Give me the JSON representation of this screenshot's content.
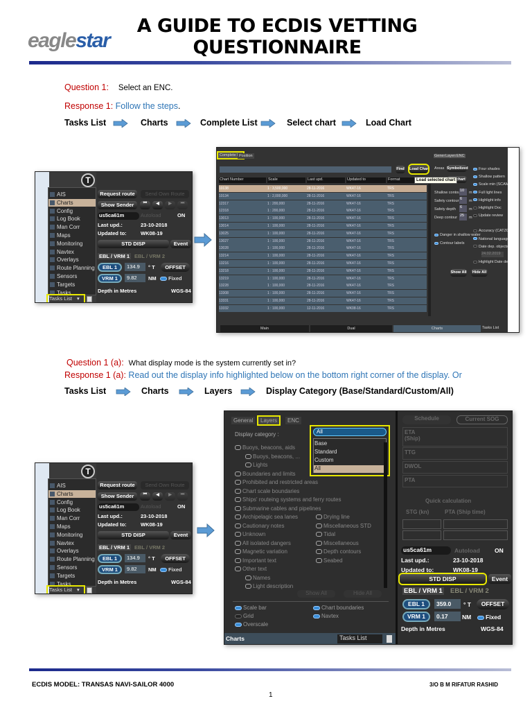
{
  "header": {
    "logo": {
      "part1": "eagle",
      "part2": "star"
    },
    "title_line1": "A GUIDE TO ECDIS VETTING",
    "title_line2": "QUESTIONNAIRE"
  },
  "q1": {
    "question_label": "Question 1:",
    "question_text": "Select an ENC.",
    "response_label": "Response 1:",
    "response_text": "Follow the steps",
    "response_end": ".",
    "steps": [
      "Tasks List",
      "Charts",
      "Complete List",
      "Select chart",
      "Load Chart"
    ]
  },
  "q1a": {
    "question_label": "Question 1 (a):",
    "question_text": "What display mode is the system currently set in?",
    "response_label": "Response 1 (a):",
    "response_text": "Read out the display info highlighted below on the bottom right corner of the display. Or",
    "steps": [
      "Tasks List",
      "Charts",
      "Layers",
      "Display Category (Base/Standard/Custom/All)"
    ]
  },
  "small_panel": {
    "t_button": "T",
    "menu": [
      "AIS",
      "Charts",
      "Config",
      "Log Book",
      "Man Corr",
      "Maps",
      "Monitoring",
      "Navtex",
      "Overlays",
      "Route Planning",
      "Sensors",
      "Targets",
      "Tasks"
    ],
    "selected": "Charts",
    "request_route": "Request route",
    "send_own_route": "Send Own Route",
    "show_sender": "Show Sender",
    "chart_select": "us5ca61m",
    "autoload": "Autoload",
    "autoload_state": "ON",
    "last_upd_label": "Last upd.:",
    "last_upd": "23-10-2018",
    "updated_to_label": "Updated to:",
    "updated_to": "WK08-19",
    "std_disp": "STD DISP",
    "event": "Event",
    "ebl_tab1": "EBL / VRM 1",
    "ebl_tab2": "EBL / VRM 2",
    "ebl1": "EBL 1",
    "ebl_value": "134.9",
    "ebl_unit": "° T",
    "offset": "OFFSET",
    "vrm1": "VRM 1",
    "vrm_value": "9.82",
    "vrm_unit": "NM",
    "fixed": "Fixed",
    "depth": "Depth in Metres",
    "datum": "WGS-84",
    "tasks_list": "Tasks List"
  },
  "chart_list": {
    "tabs": [
      "Complete list",
      "Position"
    ],
    "find": "Find",
    "load_chart": "Load Chart",
    "tooltip": "Load selected chart",
    "columns": [
      "Chart Number",
      "Scale",
      "Last upd.",
      "Updated to",
      "Format"
    ],
    "rows": [
      [
        "10138",
        "1 : 3,500,000",
        "28-11-2016",
        "WK47-16",
        "TRS"
      ],
      [
        "10134",
        "1 : 2,000,000",
        "28-11-2016",
        "WK47-16",
        "TRS"
      ],
      [
        "12317",
        "1 : 200,000",
        "28-11-2016",
        "WK47-16",
        "TRS"
      ],
      [
        "12318",
        "1 : 200,000",
        "28-11-2016",
        "WK47-16",
        "TRS"
      ],
      [
        "13013",
        "1 : 100,000",
        "28-11-2016",
        "WK47-16",
        "TRS"
      ],
      [
        "13014",
        "1 : 100,000",
        "28-11-2016",
        "WK47-16",
        "TRS"
      ],
      [
        "13025",
        "1 : 100,000",
        "28-11-2016",
        "WK47-16",
        "TRS"
      ],
      [
        "13027",
        "1 : 100,000",
        "28-11-2016",
        "WK47-16",
        "TRS"
      ],
      [
        "13028",
        "1 : 100,000",
        "28-11-2016",
        "WK47-16",
        "TRS"
      ],
      [
        "13214",
        "1 : 100,000",
        "28-11-2016",
        "WK47-16",
        "TRS"
      ],
      [
        "13216",
        "1 : 100,000",
        "28-11-2016",
        "WK47-16",
        "TRS"
      ],
      [
        "13218",
        "1 : 100,000",
        "28-11-2016",
        "WK47-16",
        "TRS"
      ],
      [
        "13219",
        "1 : 100,000",
        "28-11-2016",
        "WK47-16",
        "TRS"
      ],
      [
        "13228",
        "1 : 100,000",
        "28-11-2016",
        "WK47-16",
        "TRS"
      ],
      [
        "13308",
        "1 : 100,000",
        "28-11-2016",
        "WK47-16",
        "TRS"
      ],
      [
        "13331",
        "1 : 100,000",
        "28-11-2016",
        "WK47-16",
        "TRS"
      ],
      [
        "13332",
        "1 : 100,000",
        "12-11-2016",
        "WK08-16",
        "TRS"
      ]
    ],
    "side_tabs": [
      "General",
      "Layers",
      "ENC"
    ],
    "areas_label": "Areas",
    "areas_value": "Symbolized",
    "second_select": "Full chart",
    "contours": [
      {
        "label": "Shallow contour",
        "value": "10"
      },
      {
        "label": "Safety contour",
        "value": "6"
      },
      {
        "label": "Safety depth",
        "value": "6"
      },
      {
        "label": "Deep contour",
        "value": "25"
      }
    ],
    "left_toggles": [
      "Danger in shallow water",
      "Contour labels"
    ],
    "right_toggles": [
      {
        "label": "Four shades",
        "on": true
      },
      {
        "label": "Shallow pattern",
        "on": true
      },
      {
        "label": "Scale min (SCAMIN)",
        "on": true
      },
      {
        "label": "Full light lines",
        "on": true
      },
      {
        "label": "Highlight info",
        "on": true
      },
      {
        "label": "Highlight Doc",
        "on": false
      },
      {
        "label": "Update review",
        "on": false
      },
      {
        "label": "Accuracy (CATZOC)",
        "on": false
      },
      {
        "label": "National language",
        "on": true
      },
      {
        "label": "Date dep. objects",
        "on": false
      },
      {
        "label": "Highlight Date dep.",
        "on": false
      }
    ],
    "date_value": "24.02.2019",
    "show_all": "Show All",
    "hide_all": "Hide All",
    "bottom_tabs": [
      "Main",
      "Dual",
      "Charts"
    ],
    "tasks_list": "Tasks List"
  },
  "layers_panel": {
    "tabs": [
      "General",
      "Layers",
      "ENC"
    ],
    "display_category_label": "Display category :",
    "display_category_value": "All",
    "options": [
      "Base",
      "Standard",
      "Custom",
      "All"
    ],
    "layers_left": [
      "Buoys, beacons, aids",
      "Buoys, beacons, ...",
      "Lights",
      "Boundaries and limits",
      "Prohibited and restricted areas",
      "Chart scale boundaries",
      "Ships' routeing systems and ferry routes",
      "Submarine cables and pipelines",
      "Archipelagic sea lanes",
      "Cautionary notes",
      "Unknown",
      "All isolated dangers",
      "Magnetic variation",
      "Important text",
      "Other text",
      "Names",
      "Light description"
    ],
    "layers_right": [
      "Drying line",
      "Miscellaneous STD",
      "Tidal",
      "Miscellaneous",
      "Depth contours",
      "Seabed"
    ],
    "show_all": "Show All",
    "hide_all": "Hide All",
    "toggles": [
      {
        "label": "Scale bar",
        "on": true
      },
      {
        "label": "Chart boundaries",
        "on": true
      },
      {
        "label": "Grid",
        "on": false
      },
      {
        "label": "Navtex",
        "on": true
      },
      {
        "label": "Overscale",
        "on": true
      }
    ],
    "bottom_label": "Charts",
    "tasks_list": "Tasks List",
    "schedule": "Schedule",
    "current_sog": "Current SOG",
    "schedule_rows": [
      "ETA (Ship)",
      "TTG",
      "DWOL",
      "PTA"
    ],
    "quick_calc": "Quick calculation",
    "stg": "STG (kn)",
    "pta_ship": "PTA (Ship time)",
    "chart_select": "us5ca61m",
    "autoload": "Autoload",
    "autoload_state": "ON",
    "last_upd_label": "Last upd.:",
    "last_upd": "23-10-2018",
    "updated_to_label": "Updated to:",
    "updated_to": "WK08-19",
    "std_disp": "STD DISP",
    "event": "Event",
    "ebl_tab1": "EBL / VRM 1",
    "ebl_tab2": "EBL / VRM 2",
    "ebl1": "EBL 1",
    "ebl_value": "359.0",
    "ebl_unit": "° T",
    "offset": "OFFSET",
    "vrm1": "VRM 1",
    "vrm_value": "0.17",
    "vrm_unit": "NM",
    "fixed": "Fixed",
    "depth": "Depth in Metres",
    "datum": "WGS-84"
  },
  "footer": {
    "left": "ECDIS MODEL: TRANSAS NAVI-SAILOR 4000",
    "right": "3/O B M RIFATUR RASHID",
    "page": "1"
  },
  "colors": {
    "accent_red": "#c00000",
    "accent_blue": "#2e75b6",
    "highlight": "#e8e800",
    "ui_bg": "#3a3a3a"
  }
}
